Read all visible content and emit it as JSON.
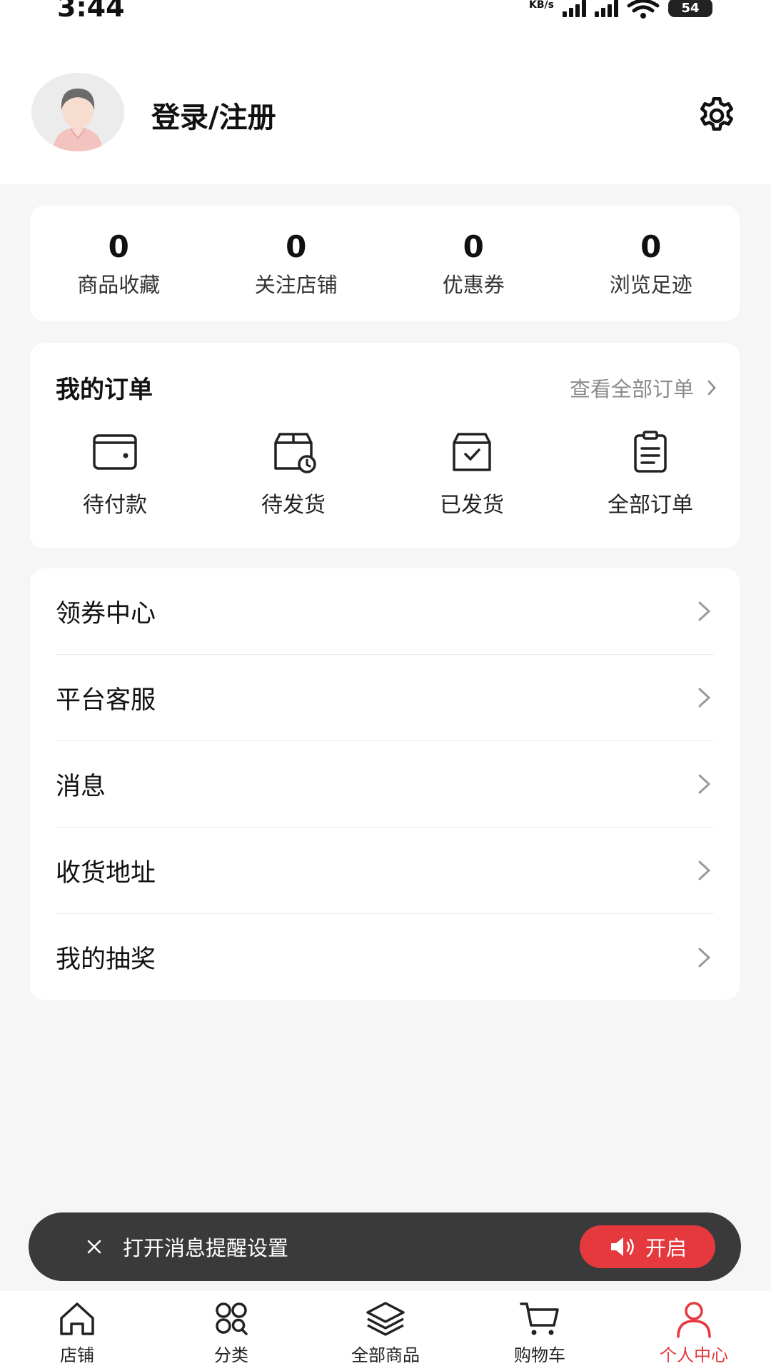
{
  "status_bar": {
    "time": "3:44",
    "net_speed": "KB/s",
    "battery": "54"
  },
  "profile": {
    "login_label": "登录/注册"
  },
  "stats": [
    {
      "value": "0",
      "label": "商品收藏"
    },
    {
      "value": "0",
      "label": "关注店铺"
    },
    {
      "value": "0",
      "label": "优惠券"
    },
    {
      "value": "0",
      "label": "浏览足迹"
    }
  ],
  "orders": {
    "title": "我的订单",
    "view_all": "查看全部订单",
    "items": [
      {
        "label": "待付款",
        "icon": "wallet-icon"
      },
      {
        "label": "待发货",
        "icon": "box-clock-icon"
      },
      {
        "label": "已发货",
        "icon": "box-check-icon"
      },
      {
        "label": "全部订单",
        "icon": "clipboard-icon"
      }
    ]
  },
  "menu": [
    {
      "label": "领券中心"
    },
    {
      "label": "平台客服"
    },
    {
      "label": "消息"
    },
    {
      "label": "收货地址"
    },
    {
      "label": "我的抽奖"
    }
  ],
  "toast": {
    "text": "打开消息提醒设置",
    "button": "开启"
  },
  "tabs": [
    {
      "label": "店铺",
      "icon": "home-icon"
    },
    {
      "label": "分类",
      "icon": "category-icon"
    },
    {
      "label": "全部商品",
      "icon": "layers-icon"
    },
    {
      "label": "购物车",
      "icon": "cart-icon"
    },
    {
      "label": "个人中心",
      "icon": "user-icon",
      "active": true
    }
  ],
  "colors": {
    "accent": "#e5393e",
    "toast_bg": "#3a3a3a",
    "page_bg": "#f6f6f6"
  }
}
